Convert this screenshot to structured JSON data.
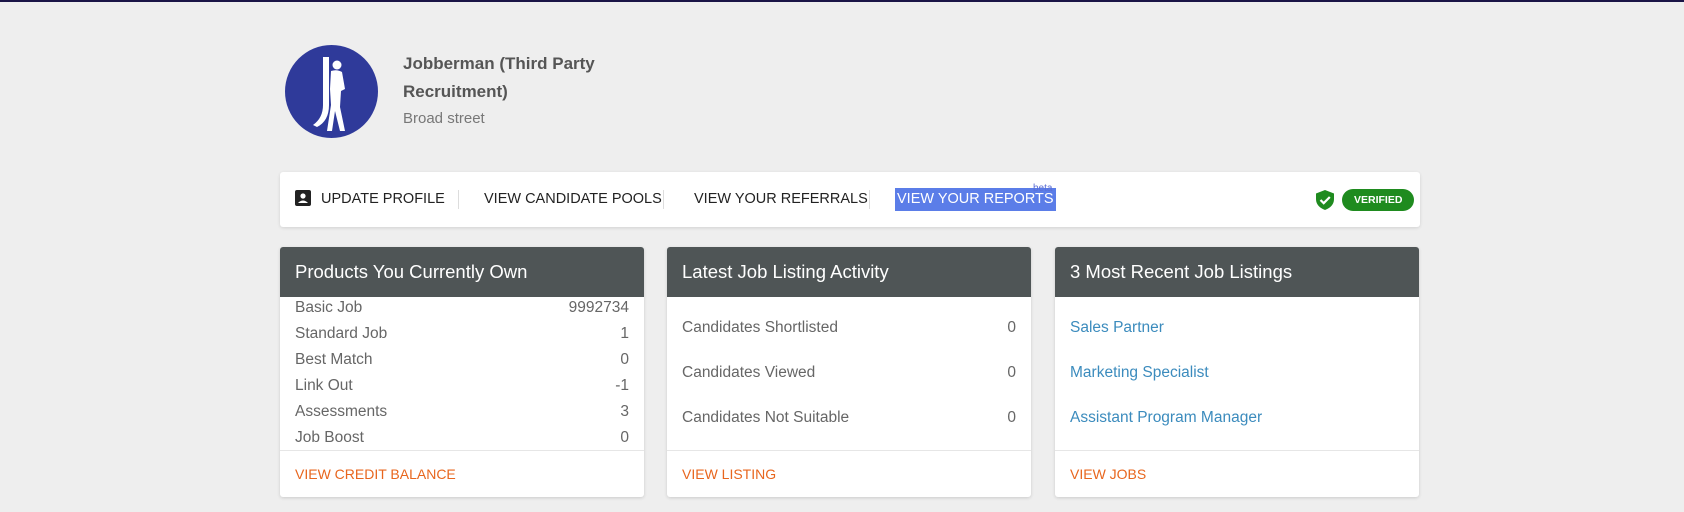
{
  "profile": {
    "company_name": "Jobberman (Third Party Recruitment)",
    "address": "Broad street"
  },
  "nav": {
    "update_profile": "UPDATE PROFILE",
    "view_candidate_pools": "VIEW CANDIDATE POOLS",
    "view_referrals": "VIEW YOUR REFERRALS",
    "view_reports": "VIEW YOUR REPORTS",
    "beta": "beta",
    "verified": "VERIFIED"
  },
  "products": {
    "title": "Products You Currently Own",
    "rows": [
      {
        "label": "Basic Job",
        "value": "9992734"
      },
      {
        "label": "Standard Job",
        "value": "1"
      },
      {
        "label": "Best Match",
        "value": "0"
      },
      {
        "label": "Link Out",
        "value": "-1"
      },
      {
        "label": "Assessments",
        "value": "3"
      },
      {
        "label": "Job Boost",
        "value": "0"
      }
    ],
    "footer": "VIEW CREDIT BALANCE"
  },
  "activity": {
    "title": "Latest Job Listing Activity",
    "rows": [
      {
        "label": "Candidates Shortlisted",
        "value": "0"
      },
      {
        "label": "Candidates Viewed",
        "value": "0"
      },
      {
        "label": "Candidates Not Suitable",
        "value": "0"
      }
    ],
    "footer": "VIEW LISTING"
  },
  "listings": {
    "title": "3 Most Recent Job Listings",
    "items": [
      "Sales Partner",
      "Marketing Specialist",
      "Assistant Program Manager"
    ],
    "footer": "VIEW JOBS"
  },
  "colors": {
    "avatar_bg": "#2f3a9a",
    "card_header": "#4f5556",
    "link": "#3b8bbd",
    "footer_link": "#e8661e",
    "verified": "#1f8b1f",
    "highlight": "#5b7de8"
  }
}
